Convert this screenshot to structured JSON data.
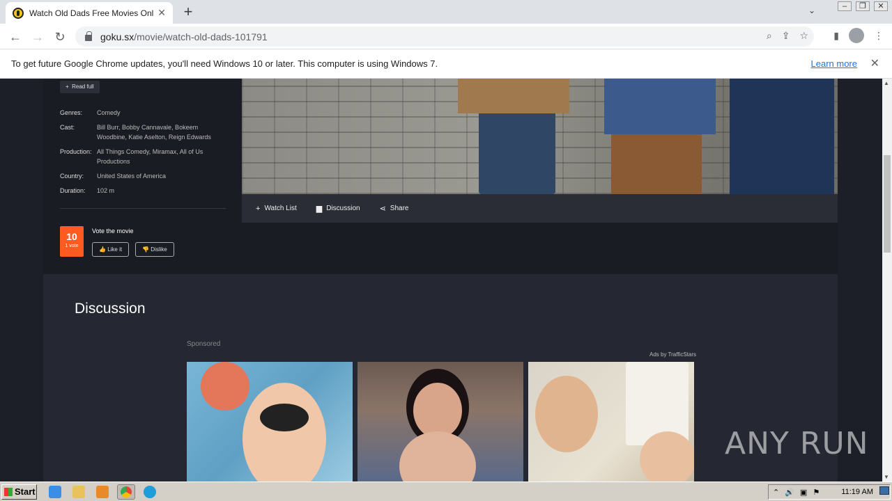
{
  "browser": {
    "tab_title": "Watch Old Dads Free Movies Online",
    "url_host": "goku.sx",
    "url_path": "/movie/watch-old-dads-101791",
    "new_tab": "+",
    "tab_close": "✕"
  },
  "infobar": {
    "message": "To get future Google Chrome updates, you'll need Windows 10 or later. This computer is using Windows 7.",
    "learn_more": "Learn more",
    "close": "✕"
  },
  "movie": {
    "read_full": "Read full",
    "meta": [
      {
        "key": "Genres:",
        "value": "Comedy"
      },
      {
        "key": "Cast:",
        "value": "Bill Burr, Bobby Cannavale, Bokeem Woodbine, Katie Aselton, Reign Edwards"
      },
      {
        "key": "Production:",
        "value": "All Things Comedy, Miramax, All of Us Productions"
      },
      {
        "key": "Country:",
        "value": "United States of America"
      },
      {
        "key": "Duration:",
        "value": "102 m"
      }
    ],
    "vote": {
      "score": "10",
      "count": "1 vote",
      "label": "Vote the movie",
      "like": "Like it",
      "dislike": "Dislike"
    },
    "actions": {
      "watch_list": "Watch List",
      "discussion": "Discussion",
      "share": "Share"
    }
  },
  "discussion": {
    "title": "Discussion",
    "sponsored": "Sponsored",
    "ads_by": "Ads by TrafficStars"
  },
  "watermark": "ANY RUN",
  "taskbar": {
    "start": "Start",
    "clock": "11:19 AM"
  }
}
